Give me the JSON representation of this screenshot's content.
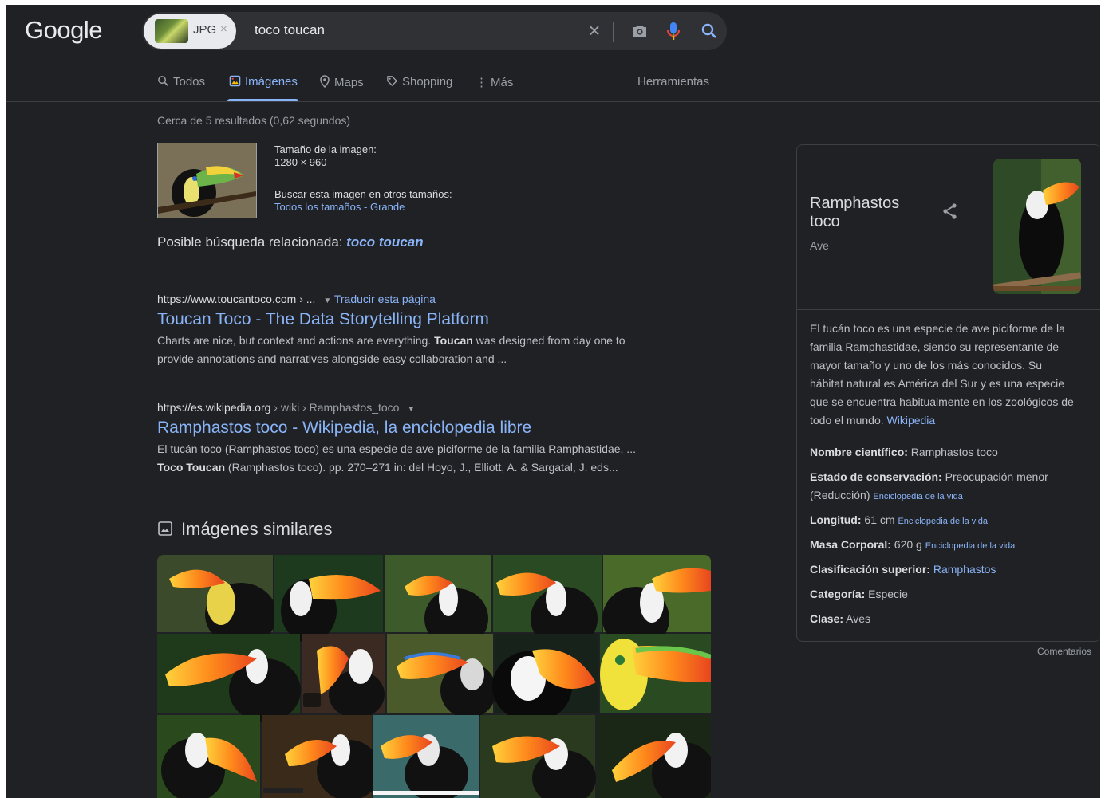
{
  "header": {
    "logo": "Google",
    "chip_label": "JPG",
    "chip_close": "×",
    "query": "toco toucan",
    "clear": "×"
  },
  "tabs": [
    {
      "label": "Todos",
      "icon": "search-icon"
    },
    {
      "label": "Imágenes",
      "icon": "image-icon",
      "active": true
    },
    {
      "label": "Maps",
      "icon": "map-pin-icon"
    },
    {
      "label": "Shopping",
      "icon": "tag-icon"
    },
    {
      "label": "Más",
      "icon": "more-vert-icon"
    }
  ],
  "tools_label": "Herramientas",
  "stats": "Cerca de 5 resultados (0,62 segundos)",
  "image_info": {
    "size_label": "Tamaño de la imagen:",
    "size_value": "1280 × 960",
    "other_sizes_label": "Buscar esta imagen en otros tamaños:",
    "all_sizes": "Todos los tamaños",
    "dash": " - ",
    "large": "Grande"
  },
  "related": {
    "prefix": "Posible búsqueda relacionada:",
    "query": "toco toucan"
  },
  "results": [
    {
      "url": "https://www.toucantoco.com › ...",
      "translate": "Traducir esta página",
      "title": "Toucan Toco - The Data Storytelling Platform",
      "snippet_line1_a": "Charts are nice, but context and actions are everything. ",
      "snippet_line1_bold": "Toucan",
      "snippet_line1_b": " was designed from day one to",
      "snippet_line2": "provide annotations and narratives alongside easy collaboration and ..."
    },
    {
      "url_domain": "https://es.wikipedia.org",
      "url_path": " › wiki › Ramphastos_toco",
      "title": "Ramphastos toco - Wikipedia, la enciclopedia libre",
      "snippet_line1": "El tucán toco (Ramphastos toco) es una especie de ave piciforme de la familia Ramphastidae, ...",
      "snippet_line2_bold": "Toco Toucan",
      "snippet_line2": " (Ramphastos toco). pp. 270–271 in: del Hoyo, J., Elliott, A. & Sargatal, J. eds..."
    }
  ],
  "similar_heading": "Imágenes similares",
  "knowledge_panel": {
    "title_line1": "Ramphastos",
    "title_line2": "toco",
    "subtitle": "Ave",
    "description_lines": [
      "El tucán toco es una especie de ave piciforme de la",
      "familia Ramphastidae, siendo su representante de",
      "mayor tamaño y uno de los más conocidos. Su",
      "hábitat natural es América del Sur y es una especie",
      "que se encuentra habitualmente en los zoológicos de",
      "todo el mundo."
    ],
    "description_source": "Wikipedia",
    "facts": {
      "scientific_label": "Nombre científico:",
      "scientific_value": " Ramphastos toco",
      "conservation_label": "Estado de conservación:",
      "conservation_value": " Preocupación menor",
      "conservation_value2": "(Reducción)",
      "conservation_source": "Enciclopedia de la vida",
      "length_label": "Longitud:",
      "length_value": " 61 cm",
      "length_source": "Enciclopedia de la vida",
      "mass_label": "Masa Corporal:",
      "mass_value": " 620 g",
      "mass_source": "Enciclopedia de la vida",
      "higher_label": "Clasificación superior:",
      "higher_value": "Ramphastos",
      "category_label": "Categoría:",
      "category_value": " Especie",
      "class_label": "Clase:",
      "class_value": " Aves"
    },
    "feedback": "Comentarios"
  },
  "colors": {
    "background": "#202124",
    "link": "#8ab4f8",
    "text": "#bdc1c6",
    "muted": "#9aa0a6"
  }
}
